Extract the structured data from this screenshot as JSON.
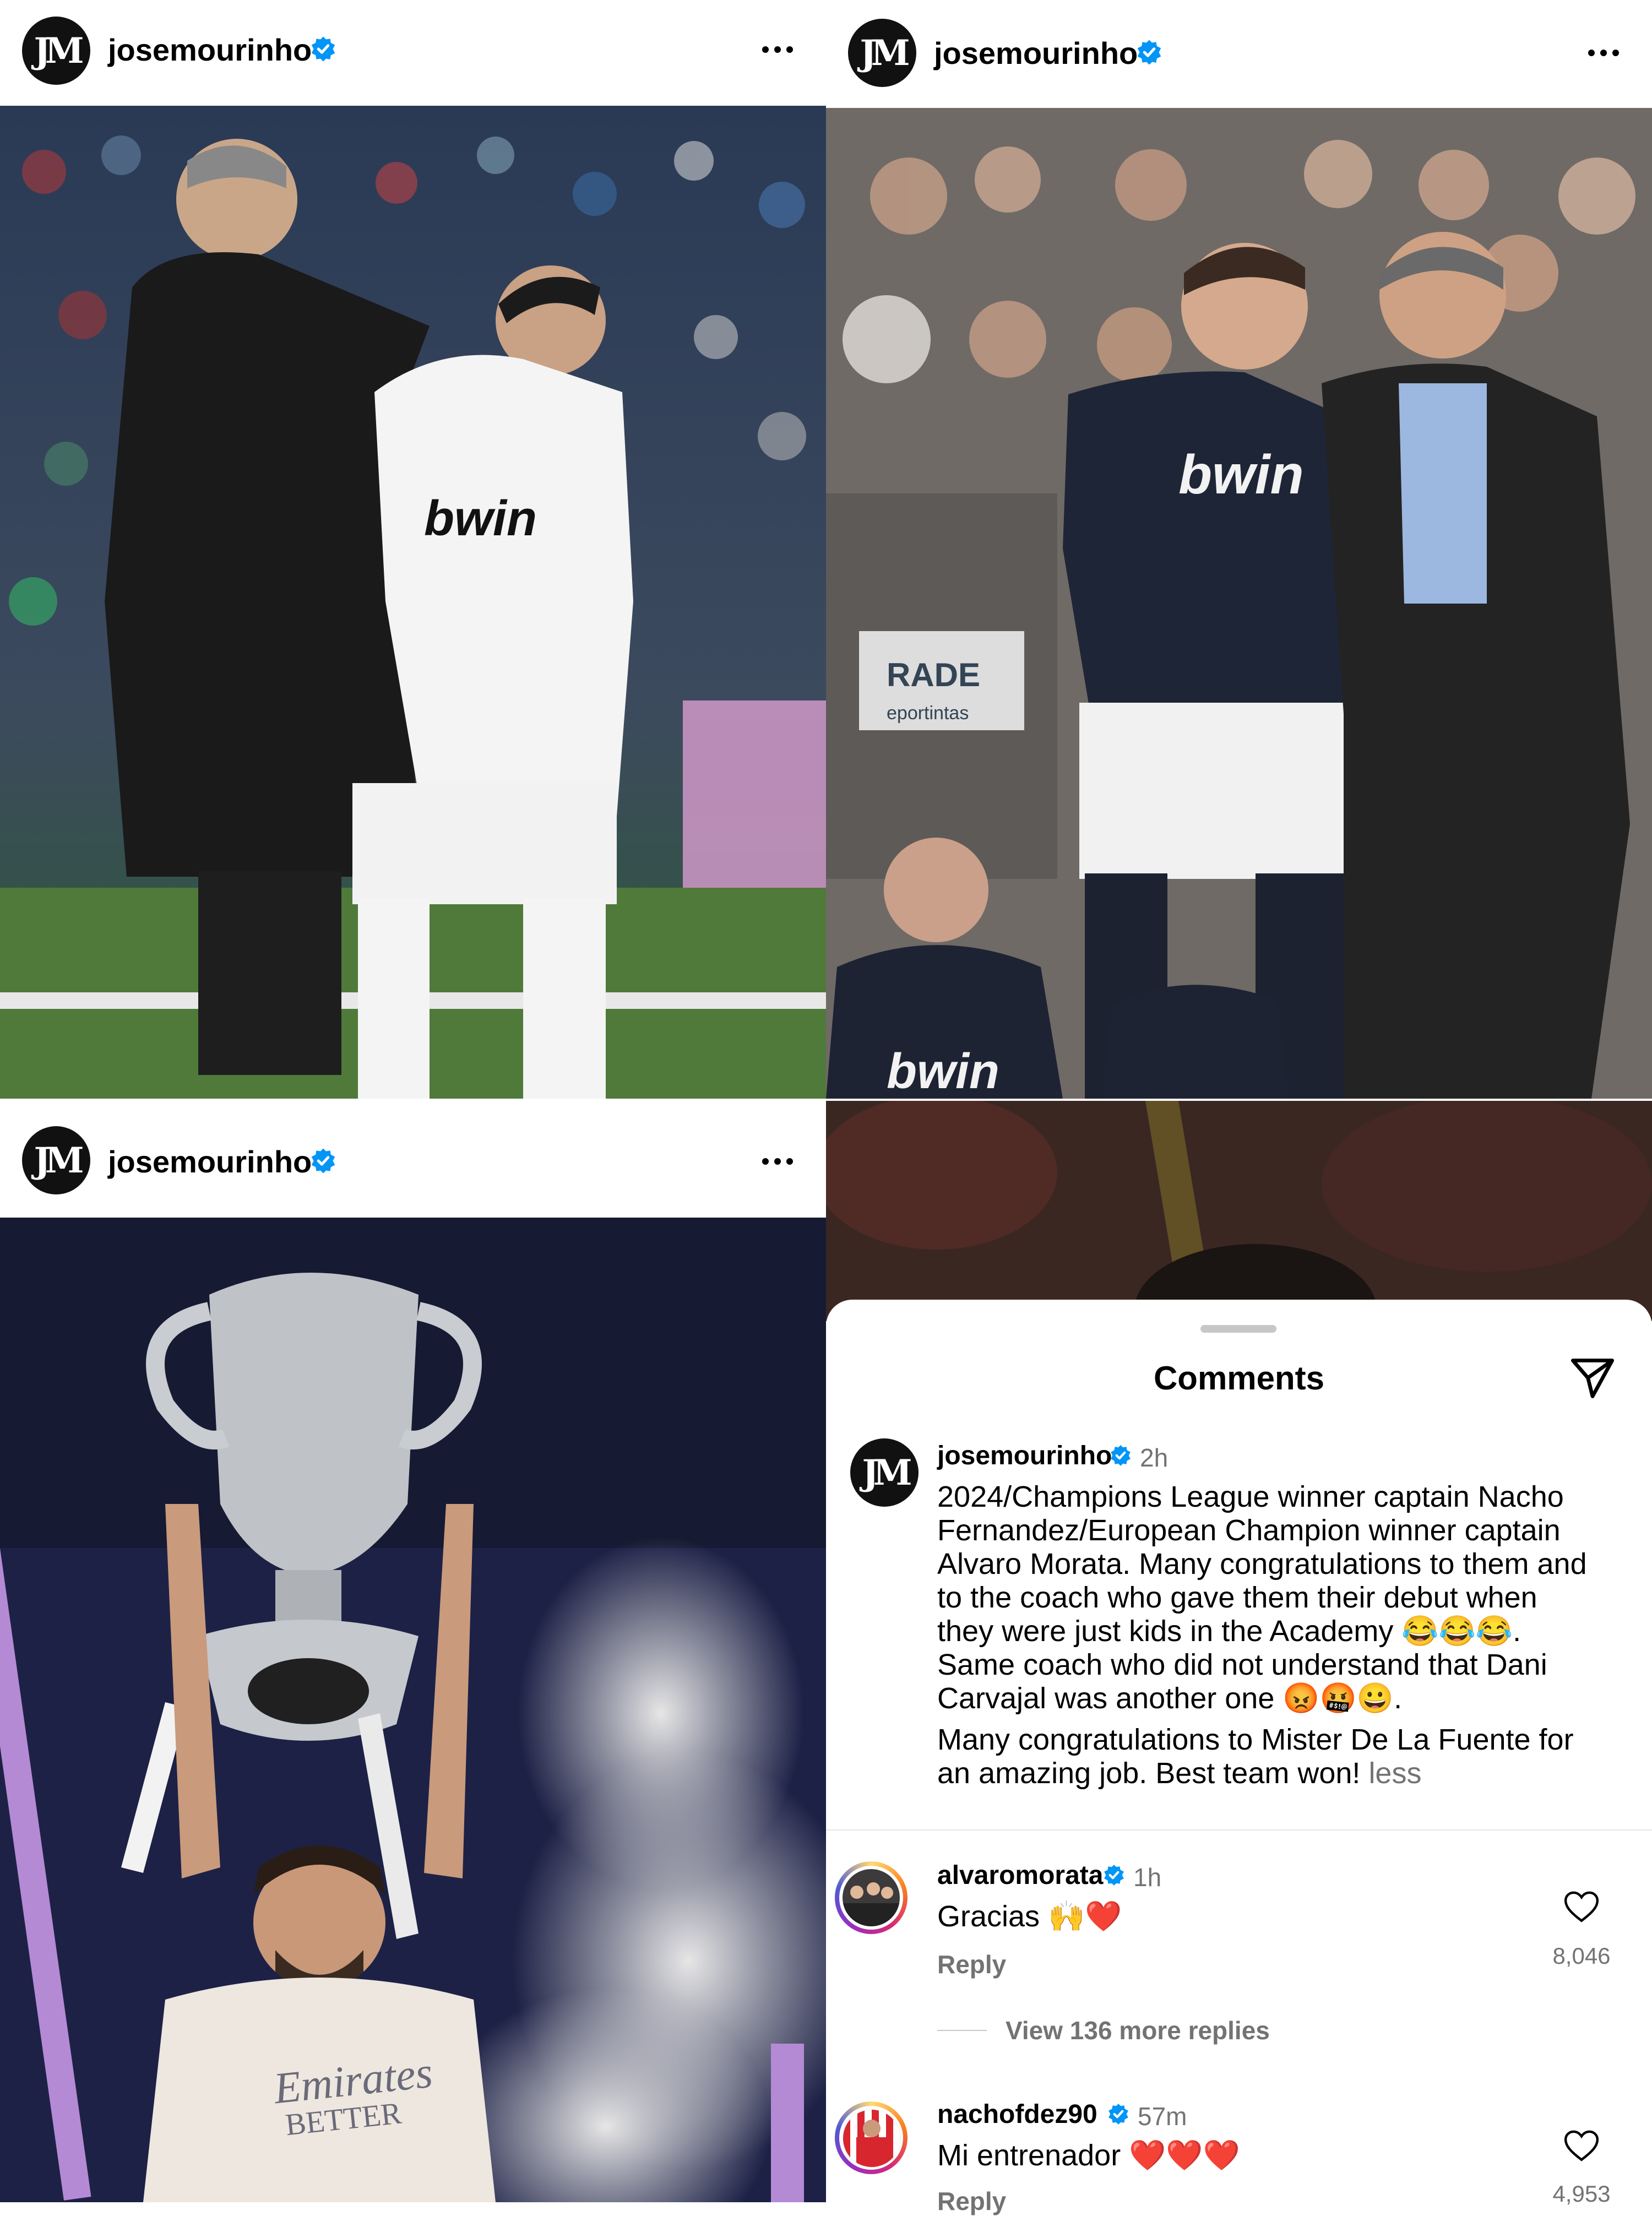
{
  "posts": [
    {
      "username": "josemourinho",
      "verified": true,
      "avatar": "jm-logo-avatar"
    },
    {
      "username": "josemourinho",
      "verified": true,
      "avatar": "jm-logo-avatar"
    },
    {
      "username": "josemourinho",
      "verified": true,
      "avatar": "jm-logo-avatar"
    }
  ],
  "photo_text": {
    "shirt_sponsor_1": "bwin",
    "shirt_sponsor_2": "bwin",
    "board_text": "RADE",
    "board_sub": "eportintas",
    "shirt_sponsor_3": "Emirates",
    "shirt_sub_3": "BETTER"
  },
  "comments": {
    "title": "Comments",
    "main": {
      "username": "josemourinho",
      "time": "2h",
      "text_lines": [
        "2024/Champions League winner captain Nacho",
        "Fernandez/European Champion winner captain",
        "Alvaro Morata. Many congratulations to them and",
        "to the coach who gave them their debut when",
        "they were just kids in the Academy 😂😂😂.",
        "Same coach who did not understand that Dani",
        "Carvajal was another one 😡🤬😀."
      ],
      "text2_lines": [
        "Many congratulations to Mister De La Fuente for",
        "an amazing job. Best team won!"
      ],
      "less": "less"
    },
    "list": [
      {
        "username": "alvaromorata",
        "time": "1h",
        "text": "Gracias 🙌❤️",
        "reply": "Reply",
        "likes": "8,046",
        "view_replies": "View 136 more replies"
      },
      {
        "username": "nachofdez90",
        "time": "57m",
        "text": "Mi entrenador ❤️❤️❤️",
        "reply": "Reply",
        "likes": "4,953"
      }
    ]
  },
  "colors": {
    "verified": "#0095F6",
    "muted": "#737373",
    "heart": "#FF2D3C"
  }
}
